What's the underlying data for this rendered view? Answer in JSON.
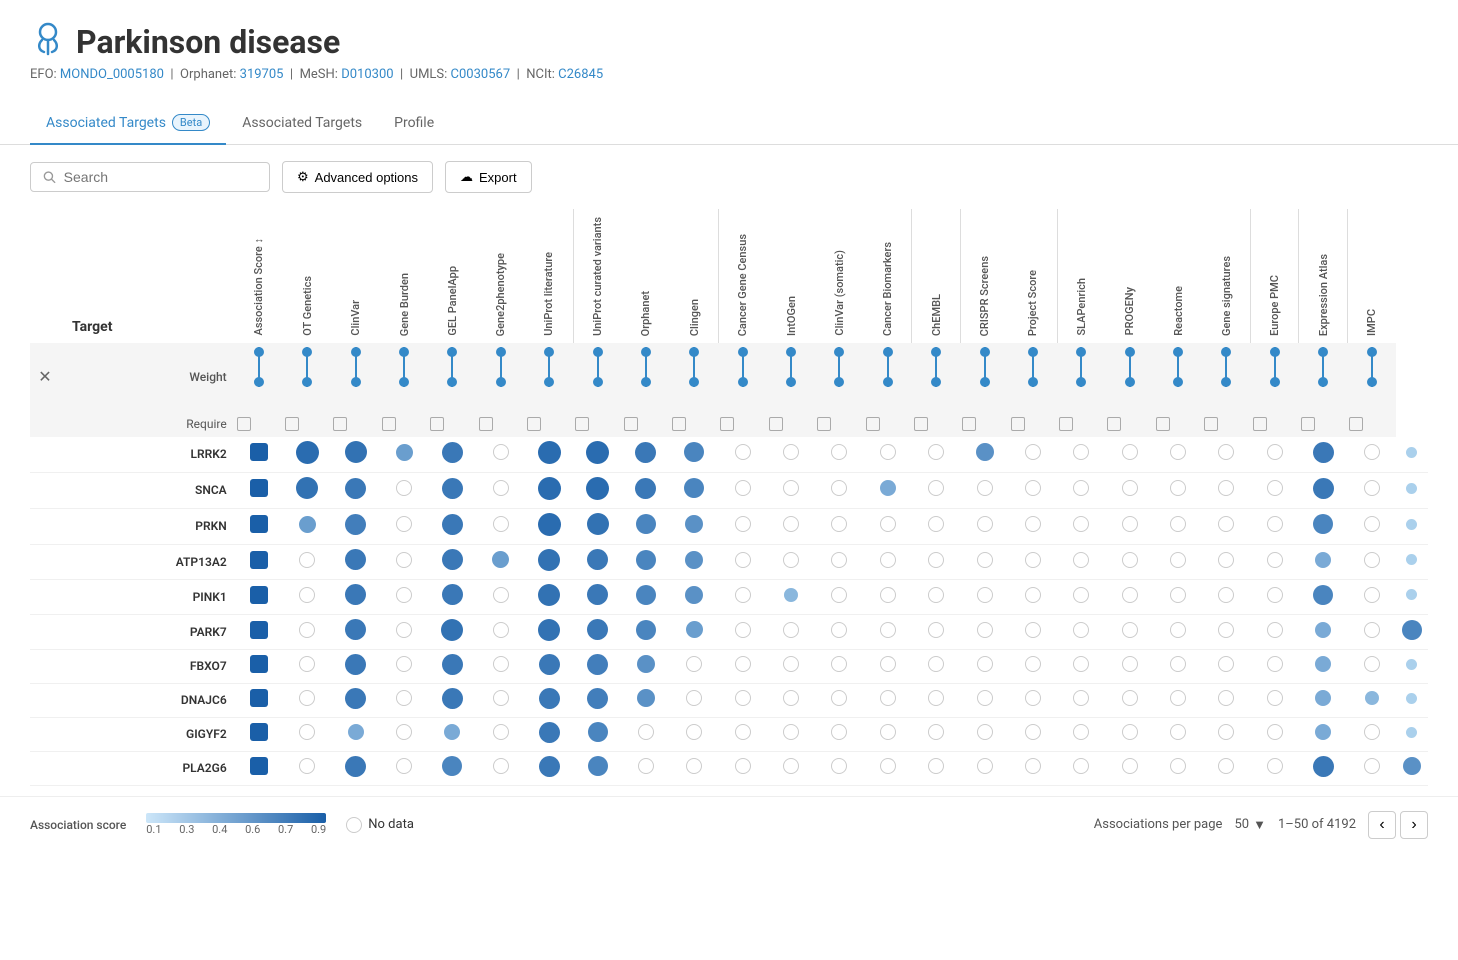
{
  "header": {
    "icon": "🔗",
    "title": "Parkinson disease",
    "ids": {
      "efo_label": "EFO:",
      "efo_val": "MONDO_0005180",
      "orphanet_label": "Orphanet:",
      "orphanet_val": "319705",
      "mesh_label": "MeSH:",
      "mesh_val": "D010300",
      "umls_label": "UMLS:",
      "umls_val": "C0030567",
      "ncit_label": "NCIt:",
      "ncit_val": "C26845"
    }
  },
  "tabs": [
    {
      "id": "assoc-beta",
      "label": "Associated Targets",
      "badge": "Beta",
      "active": true
    },
    {
      "id": "assoc",
      "label": "Associated Targets",
      "active": false
    },
    {
      "id": "profile",
      "label": "Profile",
      "active": false
    }
  ],
  "toolbar": {
    "search_placeholder": "Search",
    "advanced_options_label": "Advanced options",
    "export_label": "Export"
  },
  "columns": [
    {
      "id": "assoc-score",
      "label": "Association Score",
      "group": "score"
    },
    {
      "id": "ot-genetics",
      "label": "OT Genetics",
      "group": "genetics"
    },
    {
      "id": "clinvar",
      "label": "ClinVar",
      "group": "genetics"
    },
    {
      "id": "gene-burden",
      "label": "Gene Burden",
      "group": "genetics"
    },
    {
      "id": "gel-panelapp",
      "label": "GEL PanelApp",
      "group": "genetics"
    },
    {
      "id": "gene2phenotype",
      "label": "Gene2phenotype",
      "group": "genetics"
    },
    {
      "id": "uniprot-lit",
      "label": "UniProt literature",
      "group": "literature"
    },
    {
      "id": "uniprot-curated",
      "label": "UniProt curated variants",
      "group": "literature"
    },
    {
      "id": "orphanet",
      "label": "Orphanet",
      "group": "literature"
    },
    {
      "id": "clingen",
      "label": "Clingen",
      "group": "literature"
    },
    {
      "id": "cancer-gene-census",
      "label": "Cancer Gene Census",
      "group": "cancer"
    },
    {
      "id": "intogen",
      "label": "IntOGen",
      "group": "cancer"
    },
    {
      "id": "clinvar-somatic",
      "label": "ClinVar (somatic)",
      "group": "cancer"
    },
    {
      "id": "cancer-biomarkers",
      "label": "Cancer Biomarkers",
      "group": "cancer"
    },
    {
      "id": "chembl",
      "label": "ChEMBL",
      "group": "drugs"
    },
    {
      "id": "crispr-screens",
      "label": "CRISPR Screens",
      "group": "functional"
    },
    {
      "id": "project-score",
      "label": "Project Score",
      "group": "functional"
    },
    {
      "id": "slapanrich",
      "label": "SLAPenrich",
      "group": "pathways"
    },
    {
      "id": "progeny",
      "label": "PROGENy",
      "group": "pathways"
    },
    {
      "id": "reactome",
      "label": "Reactome",
      "group": "pathways"
    },
    {
      "id": "gene-signatures",
      "label": "Gene signatures",
      "group": "pathways"
    },
    {
      "id": "europe-pmc",
      "label": "Europe PMC",
      "group": "text-mining"
    },
    {
      "id": "expression-atlas",
      "label": "Expression Atlas",
      "group": "expression"
    },
    {
      "id": "impc",
      "label": "IMPC",
      "group": "animal"
    }
  ],
  "weight_require": {
    "weight_label": "Weight",
    "require_label": "Require"
  },
  "rows": [
    {
      "target": "LRRK2",
      "score": "#1a5fa8",
      "scores": [
        0.9,
        0.85,
        0.5,
        0.8,
        0,
        0.9,
        0.9,
        0.8,
        0.7,
        0,
        0,
        0,
        0,
        0,
        0.6,
        0,
        0,
        0,
        0,
        0,
        0,
        0.8,
        0,
        0.1
      ]
    },
    {
      "target": "SNCA",
      "score": "#1a5fa8",
      "scores": [
        0.85,
        0.8,
        0,
        0.8,
        0,
        0.9,
        0.9,
        0.8,
        0.7,
        0,
        0,
        0,
        0.4,
        0,
        0,
        0,
        0,
        0,
        0,
        0,
        0,
        0.8,
        0,
        0.1
      ]
    },
    {
      "target": "PRKN",
      "score": "#1a5fa8",
      "scores": [
        0.5,
        0.75,
        0,
        0.8,
        0,
        0.9,
        0.85,
        0.7,
        0.6,
        0,
        0,
        0,
        0,
        0,
        0,
        0,
        0,
        0,
        0,
        0,
        0,
        0.7,
        0,
        0.1
      ]
    },
    {
      "target": "ATP13A2",
      "score": "#1a5fa8",
      "scores": [
        0,
        0.8,
        0,
        0.8,
        0.5,
        0.85,
        0.8,
        0.7,
        0.6,
        0,
        0,
        0,
        0,
        0,
        0,
        0,
        0,
        0,
        0,
        0,
        0,
        0.4,
        0,
        0.1
      ]
    },
    {
      "target": "PINK1",
      "score": "#1a5fa8",
      "scores": [
        0,
        0.8,
        0,
        0.8,
        0,
        0.85,
        0.8,
        0.7,
        0.6,
        0,
        0.3,
        0,
        0,
        0,
        0,
        0,
        0,
        0,
        0,
        0,
        0,
        0.7,
        0,
        0.1
      ]
    },
    {
      "target": "PARK7",
      "score": "#1a5fa8",
      "scores": [
        0,
        0.8,
        0,
        0.85,
        0,
        0.85,
        0.8,
        0.7,
        0.5,
        0,
        0,
        0,
        0,
        0,
        0,
        0,
        0,
        0,
        0,
        0,
        0,
        0.4,
        0,
        0.7
      ]
    },
    {
      "target": "FBXO7",
      "score": "#1a5fa8",
      "scores": [
        0,
        0.8,
        0,
        0.8,
        0,
        0.8,
        0.75,
        0.6,
        0,
        0,
        0,
        0,
        0,
        0,
        0,
        0,
        0,
        0,
        0,
        0,
        0,
        0.4,
        0,
        0.1
      ]
    },
    {
      "target": "DNAJC6",
      "score": "#1a5fa8",
      "scores": [
        0,
        0.8,
        0,
        0.8,
        0,
        0.8,
        0.75,
        0.6,
        0,
        0,
        0,
        0,
        0,
        0,
        0,
        0,
        0,
        0,
        0,
        0,
        0,
        0.4,
        0.3,
        0.1
      ]
    },
    {
      "target": "GIGYF2",
      "score": "#1a5fa8",
      "scores": [
        0,
        0.4,
        0,
        0.4,
        0,
        0.8,
        0.7,
        0,
        0,
        0,
        0,
        0,
        0,
        0,
        0,
        0,
        0,
        0,
        0,
        0,
        0,
        0.4,
        0,
        0.1
      ]
    },
    {
      "target": "PLA2G6",
      "score": "#1a5fa8",
      "scores": [
        0,
        0.8,
        0,
        0.7,
        0,
        0.8,
        0.7,
        0,
        0,
        0,
        0,
        0,
        0,
        0,
        0,
        0,
        0,
        0,
        0,
        0,
        0,
        0.8,
        0,
        0.6
      ]
    }
  ],
  "legend": {
    "assoc_score_label": "Association score",
    "scale_min": "0.1",
    "scale_03": "0.3",
    "scale_04": "0.4",
    "scale_06": "0.6",
    "scale_07": "0.7",
    "scale_09": "0.9",
    "no_data_label": "No data"
  },
  "pagination": {
    "per_page_label": "Associations per page",
    "per_page_value": "50",
    "range_label": "1–50 of 4192"
  }
}
